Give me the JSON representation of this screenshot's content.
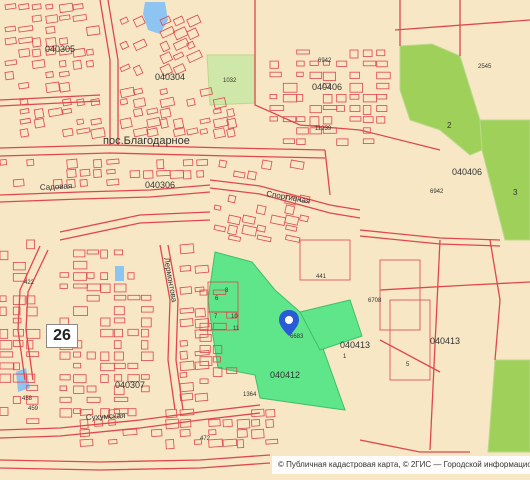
{
  "map": {
    "route_number": "26",
    "locality_label": "пос.Благодарное",
    "attribution": "© Публичная кадастровая карта, © 2ГИС — Городской информационн",
    "quarter_labels": [
      "040305",
      "040304",
      "040306",
      "040307",
      "040406",
      "040412",
      "040413",
      "040406b"
    ],
    "parcel_numbers": [
      "1032",
      "6942",
      "2545",
      "11239",
      "441",
      "6708",
      "6683",
      "6942b",
      "458",
      "459",
      "1364",
      "472",
      "422",
      "2",
      "3",
      "8",
      "6",
      "7",
      "10",
      "11",
      "1",
      "5"
    ],
    "street_labels": [
      "Спортивная",
      "Садовая",
      "Лермонтова",
      "Сухумская"
    ],
    "colors": {
      "background": "#f7e7c4",
      "parcel_outline": "#e0474d",
      "selected_parcel": "#5fe58a",
      "forest": "#9ed05a",
      "water": "#8ec4f2",
      "pin": "#2a5bd7"
    },
    "selected_parcel_label": "6683"
  }
}
